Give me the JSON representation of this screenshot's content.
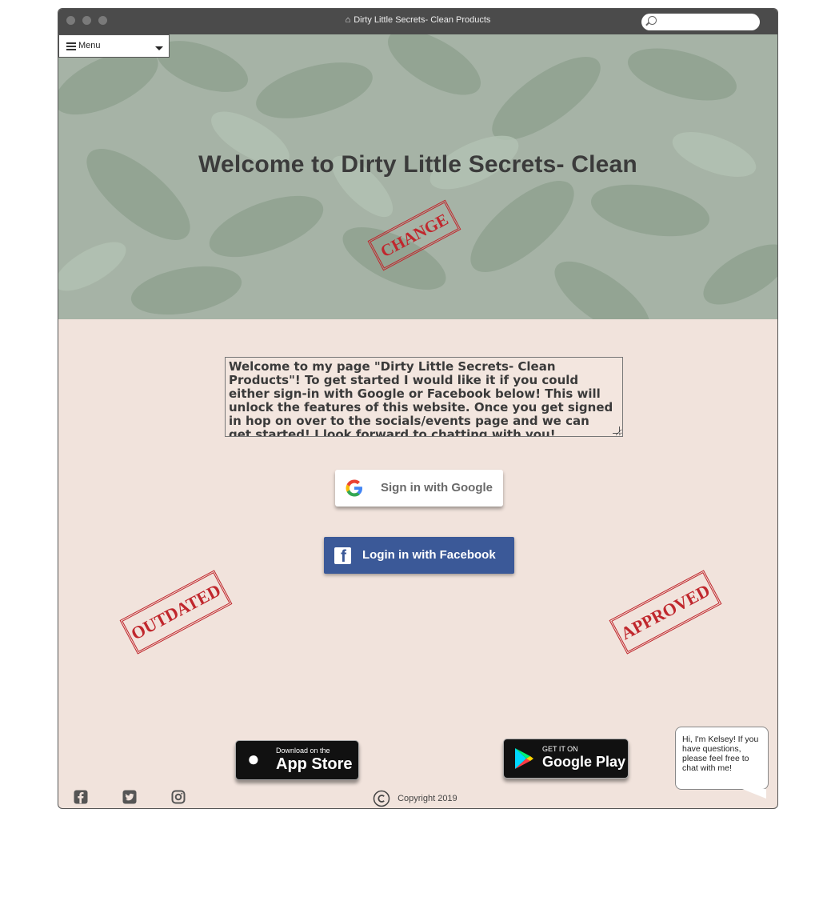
{
  "window": {
    "title": "Dirty Little Secrets- Clean Products",
    "search_placeholder": ""
  },
  "menu": {
    "label": "Menu"
  },
  "hero": {
    "heading": "Welcome to Dirty Little Secrets- Clean",
    "stamp": "CHANGE"
  },
  "intro": {
    "text": "Welcome to my page \"Dirty Little Secrets- Clean Products\"! To get started I  would like it if you could either sign-in with Google or Facebook below! This will unlock the features of this website. Once you get signed in hop on over to the socials/events page and we can get started! I look forward to chatting with you!"
  },
  "auth": {
    "google_label": "Sign in with Google",
    "facebook_label": "Login in with Facebook"
  },
  "stamps": {
    "left": "OUTDATED",
    "right": "APPROVED"
  },
  "stores": {
    "apple_small": "Download on the",
    "apple_big": "App Store",
    "google_small": "GET IT ON",
    "google_big": "Google Play"
  },
  "chat": {
    "text": "Hi, I'm Kelsey! If you have questions, please feel free to chat with me!"
  },
  "footer": {
    "copyright": "Copyright 2019"
  }
}
